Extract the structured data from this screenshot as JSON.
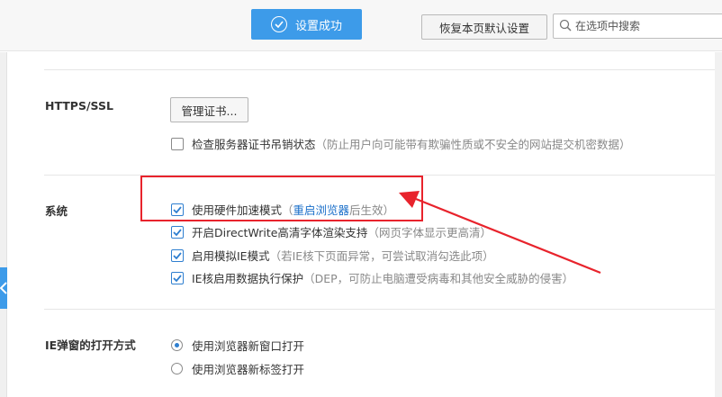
{
  "toolbar": {
    "success_label": "设置成功",
    "restore_label": "恢复本页默认设置",
    "search_placeholder": "在选项中搜索"
  },
  "https": {
    "section_label": "HTTPS/SSL",
    "manage_cert_label": "管理证书...",
    "revocation": {
      "label": "检查服务器证书吊销状态",
      "note": "（防止用户向可能带有欺骗性质或不安全的网站提交机密数据）",
      "checked": false
    }
  },
  "system": {
    "section_label": "系统",
    "options": [
      {
        "label": "使用硬件加速模式",
        "note_pre": "（",
        "link": "重启浏览器",
        "note_post": " 后生效）",
        "checked": true
      },
      {
        "label": "开启DirectWrite高清字体渲染支持",
        "note": "（网页字体显示更高清）",
        "checked": true
      },
      {
        "label": "启用模拟IE模式",
        "note": "（若IE核下页面异常，可尝试取消勾选此项）",
        "checked": true
      },
      {
        "label": "IE核启用数据执行保护",
        "note": "（DEP，可防止电脑遭受病毒和其他安全威胁的侵害）",
        "checked": true
      }
    ]
  },
  "popup": {
    "section_label": "IE弹窗的打开方式",
    "options": [
      {
        "label": "使用浏览器新窗口打开",
        "selected": true
      },
      {
        "label": "使用浏览器新标签打开",
        "selected": false
      }
    ]
  },
  "colors": {
    "accent": "#3d9be9",
    "annotation": "#e8232c",
    "link": "#1a6fc9"
  },
  "icons": [
    "check-circle-icon",
    "search-icon",
    "chevron-left-icon",
    "checkmark-icon",
    "radio-dot-icon"
  ]
}
